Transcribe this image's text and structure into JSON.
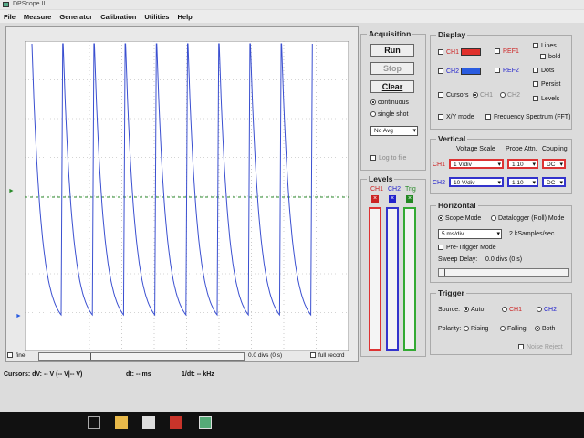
{
  "window": {
    "title": "DPScope II"
  },
  "menu": [
    "File",
    "Measure",
    "Generator",
    "Calibration",
    "Utilities",
    "Help"
  ],
  "scope": {
    "fine_label": "fine",
    "h_position": "0.0 divs (0 s)",
    "full_record_label": "full record"
  },
  "status": {
    "cursors": "Cursors:  dV: -- V  (-- V|-- V)",
    "dt": "dt: -- ms",
    "freq": "1/dt: -- kHz"
  },
  "acquisition": {
    "title": "Acquisition",
    "run": "Run",
    "stop": "Stop",
    "clear": "Clear",
    "continuous": "continuous",
    "single_shot": "single shot",
    "avg": "No Avg",
    "log_to_file": "Log to file"
  },
  "levels": {
    "title": "Levels",
    "ch1": "CH1",
    "ch2": "CH2",
    "trig": "Trig"
  },
  "display": {
    "title": "Display",
    "ch1": "CH1",
    "ch2": "CH2",
    "ref1": "REF1",
    "ref2": "REF2",
    "lines": "Lines",
    "bold": "bold",
    "dots": "Dots",
    "persist": "Persist",
    "levels": "Levels",
    "cursors": "Cursors",
    "cursor_ch1": "CH1",
    "cursor_ch2": "CH2",
    "xy_mode": "X/Y mode",
    "fft": "Frequency Spectrum (FFT)",
    "ch1_color": "#e0302c",
    "ch2_color": "#2a5ce0"
  },
  "vertical": {
    "title": "Vertical",
    "voltage_scale": "Voltage Scale",
    "probe_attn": "Probe Attn.",
    "coupling": "Coupling",
    "ch1": {
      "label": "CH1",
      "scale": "1 V/div",
      "attn": "1:10",
      "coupling": "DC"
    },
    "ch2": {
      "label": "CH2",
      "scale": "10 V/div",
      "attn": "1:10",
      "coupling": "DC"
    }
  },
  "horizontal": {
    "title": "Horizontal",
    "scope_mode": "Scope Mode",
    "datalogger": "Datalogger (Roll) Mode",
    "timebase": "5 ms/div",
    "samplerate": "2 kSamples/sec",
    "pretrigger": "Pre-Trigger Mode",
    "sweep_delay": "Sweep Delay:",
    "sweep_value": "0.0 divs (0 s)"
  },
  "trigger": {
    "title": "Trigger",
    "source": "Source:",
    "auto": "Auto",
    "ch1": "CH1",
    "ch2": "CH2",
    "polarity": "Polarity:",
    "rising": "Rising",
    "falling": "Falling",
    "both": "Both",
    "noise_reject": "Noise Reject"
  },
  "taskbar": {
    "icons": [
      "task-view-icon",
      "file-explorer-icon",
      "windows-store-icon",
      "media-player-icon",
      "dpscope-icon"
    ]
  },
  "trace": {
    "color": "#3a4fd0",
    "pulse_count": 9
  }
}
